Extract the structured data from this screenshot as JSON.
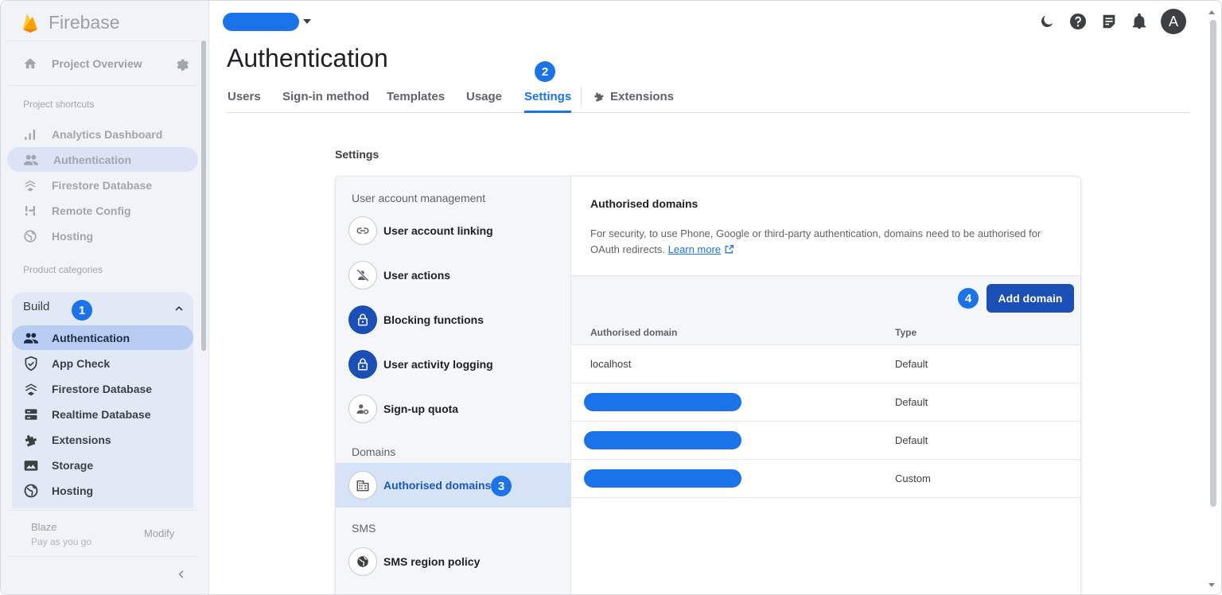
{
  "app": {
    "name": "Firebase"
  },
  "sidebar": {
    "overview_label": "Project Overview",
    "shortcuts_label": "Project shortcuts",
    "shortcuts": [
      {
        "label": "Analytics Dashboard",
        "icon": "bar-chart-icon"
      },
      {
        "label": "Authentication",
        "icon": "users-icon",
        "active": true
      },
      {
        "label": "Firestore Database",
        "icon": "firestore-icon"
      },
      {
        "label": "Remote Config",
        "icon": "remote-config-icon"
      },
      {
        "label": "Hosting",
        "icon": "globe-icon"
      }
    ],
    "categories_label": "Product categories",
    "build": {
      "label": "Build",
      "badge": "1",
      "items": [
        {
          "label": "Authentication",
          "icon": "users-icon",
          "active": true
        },
        {
          "label": "App Check",
          "icon": "shield-icon"
        },
        {
          "label": "Firestore Database",
          "icon": "firestore-icon"
        },
        {
          "label": "Realtime Database",
          "icon": "database-icon"
        },
        {
          "label": "Extensions",
          "icon": "puzzle-icon"
        },
        {
          "label": "Storage",
          "icon": "storage-icon"
        },
        {
          "label": "Hosting",
          "icon": "globe-icon"
        }
      ]
    },
    "plan": {
      "name": "Blaze",
      "desc": "Pay as you go",
      "modify_label": "Modify"
    }
  },
  "header": {
    "title": "Authentication",
    "tabs": [
      {
        "label": "Users"
      },
      {
        "label": "Sign-in method"
      },
      {
        "label": "Templates"
      },
      {
        "label": "Usage"
      },
      {
        "label": "Settings",
        "active": true,
        "badge": "2"
      },
      {
        "label": "Extensions"
      }
    ],
    "avatar_letter": "A"
  },
  "settings": {
    "label": "Settings",
    "groups": [
      {
        "title": "User account management",
        "items": [
          {
            "label": "User account linking",
            "icon": "link-icon"
          },
          {
            "label": "User actions",
            "icon": "user-off-icon"
          },
          {
            "label": "Blocking functions",
            "icon": "lock-icon"
          },
          {
            "label": "User activity logging",
            "icon": "lock-icon"
          },
          {
            "label": "Sign-up quota",
            "icon": "user-settings-icon"
          }
        ]
      },
      {
        "title": "Domains",
        "items": [
          {
            "label": "Authorised domains",
            "icon": "building-icon",
            "active": true,
            "badge": "3"
          }
        ]
      },
      {
        "title": "SMS",
        "items": [
          {
            "label": "SMS region policy",
            "icon": "globe-icon"
          }
        ]
      }
    ],
    "panel": {
      "title": "Authorised domains",
      "description": "For security, to use Phone, Google or third-party authentication, domains need to be authorised for OAuth redirects.",
      "learn_more": "Learn more",
      "add_button": "Add domain",
      "add_badge": "4",
      "columns": [
        "Authorised domain",
        "Type"
      ],
      "rows": [
        {
          "domain": "localhost",
          "type": "Default"
        },
        {
          "domain": "",
          "type": "Default",
          "redacted": true
        },
        {
          "domain": "",
          "type": "Default",
          "redacted": true
        },
        {
          "domain": "",
          "type": "Custom",
          "redacted": true
        }
      ]
    }
  },
  "colors": {
    "accent": "#1a73e8",
    "button": "#1a4fb5"
  }
}
